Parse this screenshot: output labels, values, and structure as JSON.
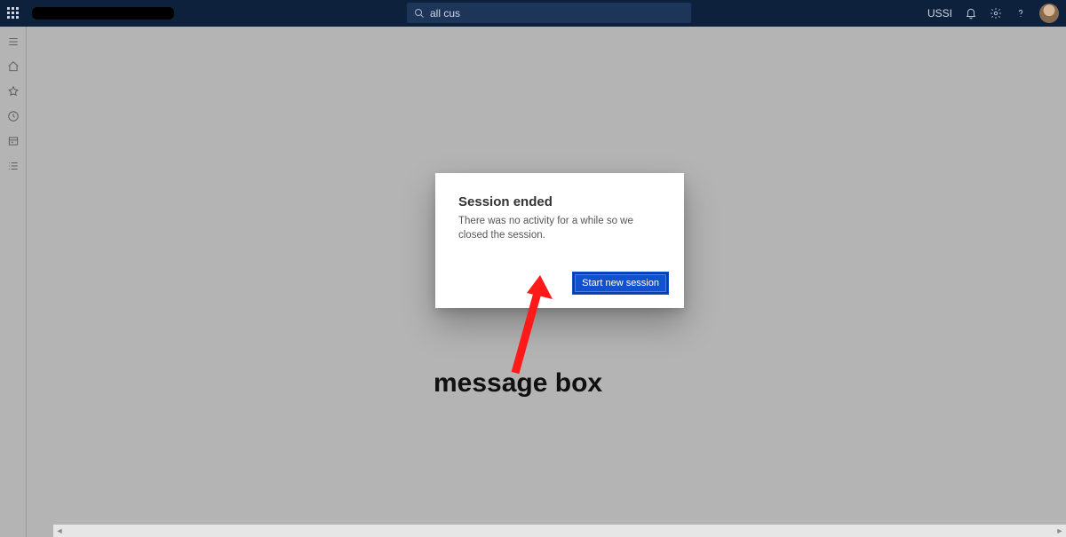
{
  "topbar": {
    "org_label": "USSI",
    "search_value": "all cus"
  },
  "dialog": {
    "title": "Session ended",
    "message": "There was no activity for a while so we closed the session.",
    "primary_button": "Start new session"
  },
  "annotation": {
    "label": "message box"
  }
}
